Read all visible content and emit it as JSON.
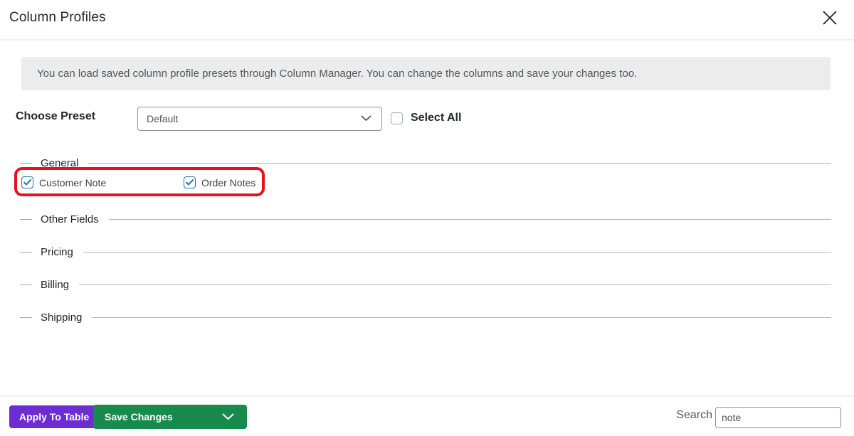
{
  "header": {
    "title": "Column Profiles"
  },
  "banner": {
    "text": "You can load saved column profile presets through Column Manager. You can change the columns and save your changes too."
  },
  "preset": {
    "label": "Choose Preset",
    "selected_option": "Default",
    "select_all_label": "Select All",
    "select_all_checked": false
  },
  "sections": [
    {
      "label": "General",
      "highlighted": true,
      "items": [
        {
          "label": "Customer Note",
          "checked": true
        },
        {
          "label": "Order Notes",
          "checked": true
        }
      ]
    },
    {
      "label": "Other Fields",
      "highlighted": false,
      "items": []
    },
    {
      "label": "Pricing",
      "highlighted": false,
      "items": []
    },
    {
      "label": "Billing",
      "highlighted": false,
      "items": []
    },
    {
      "label": "Shipping",
      "highlighted": false,
      "items": []
    }
  ],
  "footer": {
    "apply_button_label": "Apply To Table",
    "save_button_label": "Save Changes",
    "search_label": "Search",
    "search_value": "note"
  },
  "colors": {
    "apply_button_bg": "#6e2dd2",
    "save_button_bg": "#178a4c",
    "highlight_border": "#e8121d",
    "checkbox_checked_blue": "#2271b1"
  }
}
